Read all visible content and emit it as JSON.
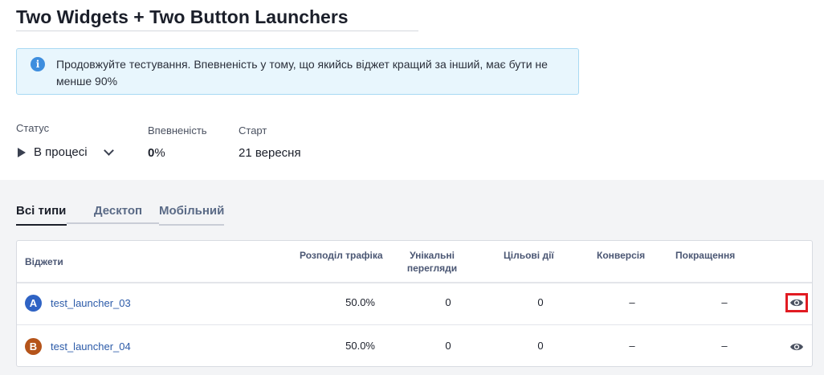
{
  "page": {
    "title": "Two Widgets + Two Button Launchers"
  },
  "info": {
    "icon": "info-icon",
    "text": "Продовжуйте тестування. Впевненість у тому, що якийсь віджет кращий за інший, має бути не менше 90%"
  },
  "summary": {
    "status_label": "Статус",
    "status_value": "В процесі",
    "confidence_label": "Впевненість",
    "confidence_number": "0",
    "confidence_unit": "%",
    "start_label": "Старт",
    "start_value": "21 вересня"
  },
  "tabs": [
    {
      "label": "Всі типи",
      "active": true
    },
    {
      "label": "Десктоп",
      "active": false
    },
    {
      "label": "Мобільний",
      "active": false
    }
  ],
  "table": {
    "headers": {
      "widgets": "Віджети",
      "traffic": "Розподіл трафіка",
      "unique_views_line1": "Унікальні",
      "unique_views_line2": "перегляди",
      "target_actions": "Цільові дії",
      "conversion": "Конверсія",
      "improvement": "Покращення"
    },
    "rows": [
      {
        "badge": "A",
        "badge_color": "#2f63c4",
        "name": "test_launcher_03",
        "traffic": "50.0%",
        "unique_views": "0",
        "target_actions": "0",
        "conversion": "–",
        "improvement": "–",
        "action_icon": "eye-icon",
        "highlighted": true
      },
      {
        "badge": "B",
        "badge_color": "#b5541a",
        "name": "test_launcher_04",
        "traffic": "50.0%",
        "unique_views": "0",
        "target_actions": "0",
        "conversion": "–",
        "improvement": "–",
        "action_icon": "eye-icon",
        "highlighted": false
      }
    ]
  },
  "colors": {
    "info_bg": "#e8f6fd",
    "highlight": "#e11b22",
    "link": "#2b5aa8"
  }
}
